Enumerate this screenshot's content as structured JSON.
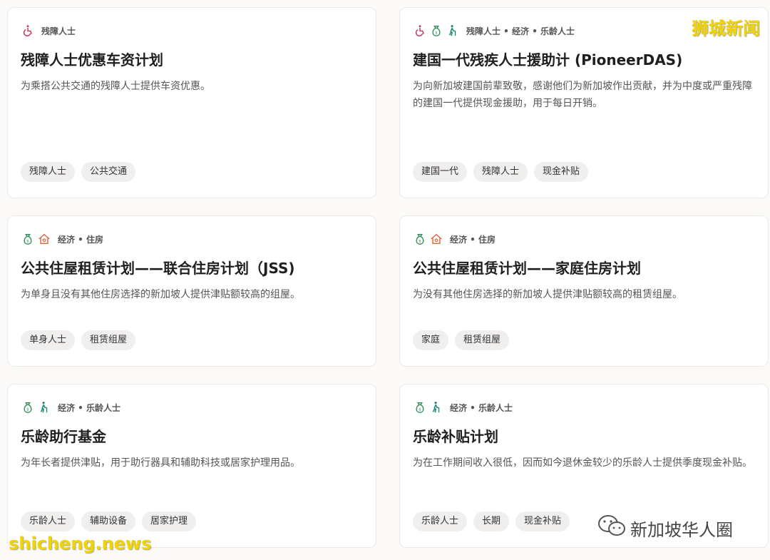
{
  "colors": {
    "accessibility": "#c2335a",
    "finance": "#2e8b57",
    "seniors": "#1f8a70",
    "housing": "#e0663a",
    "watermark": "#f2d400"
  },
  "watermarks": {
    "top_right": "狮城新闻",
    "bottom_left": "shicheng.news",
    "wechat": "新加坡华人圈"
  },
  "cards": [
    {
      "icons": [
        "wheelchair-icon"
      ],
      "category": "残障人士",
      "title": "残障人士优惠车资计划",
      "description": "为乘搭公共交通的残障人士提供车资优惠。",
      "tags": [
        "残障人士",
        "公共交通"
      ]
    },
    {
      "icons": [
        "wheelchair-icon",
        "money-bag-icon",
        "senior-walking-icon"
      ],
      "category": "残障人士 • 经济 • 乐龄人士",
      "title": "建国一代残疾人士援助计 (PioneerDAS)",
      "description": "为向新加坡建国前辈致敬，感谢他们为新加坡作出贡献，并为中度或严重残障的建国一代提供现金援助，用于每日开销。",
      "tags": [
        "建国一代",
        "残障人士",
        "现金补贴"
      ]
    },
    {
      "icons": [
        "money-bag-icon",
        "house-icon"
      ],
      "category": "经济 • 住房",
      "title": "公共住屋租赁计划——联合住房计划（JSS)",
      "description": "为单身且没有其他住房选择的新加坡人提供津贴额较高的组屋。",
      "tags": [
        "单身人士",
        "租赁组屋"
      ]
    },
    {
      "icons": [
        "money-bag-icon",
        "house-icon"
      ],
      "category": "经济 • 住房",
      "title": "公共住屋租赁计划——家庭住房计划",
      "description": "为没有其他住房选择的新加坡人提供津贴额较高的租赁组屋。",
      "tags": [
        "家庭",
        "租赁组屋"
      ]
    },
    {
      "icons": [
        "money-bag-icon",
        "senior-walking-icon"
      ],
      "category": "经济 • 乐龄人士",
      "title": "乐龄助行基金",
      "description": "为年长者提供津贴，用于助行器具和辅助科技或居家护理用品。",
      "tags": [
        "乐龄人士",
        "辅助设备",
        "居家护理"
      ]
    },
    {
      "icons": [
        "money-bag-icon",
        "senior-walking-icon"
      ],
      "category": "经济 • 乐龄人士",
      "title": "乐龄补贴计划",
      "description": "为在工作期间收入很低，因而如今退休金较少的乐龄人士提供季度现金补贴。",
      "tags": [
        "乐龄人士",
        "长期",
        "现金补贴"
      ]
    }
  ]
}
